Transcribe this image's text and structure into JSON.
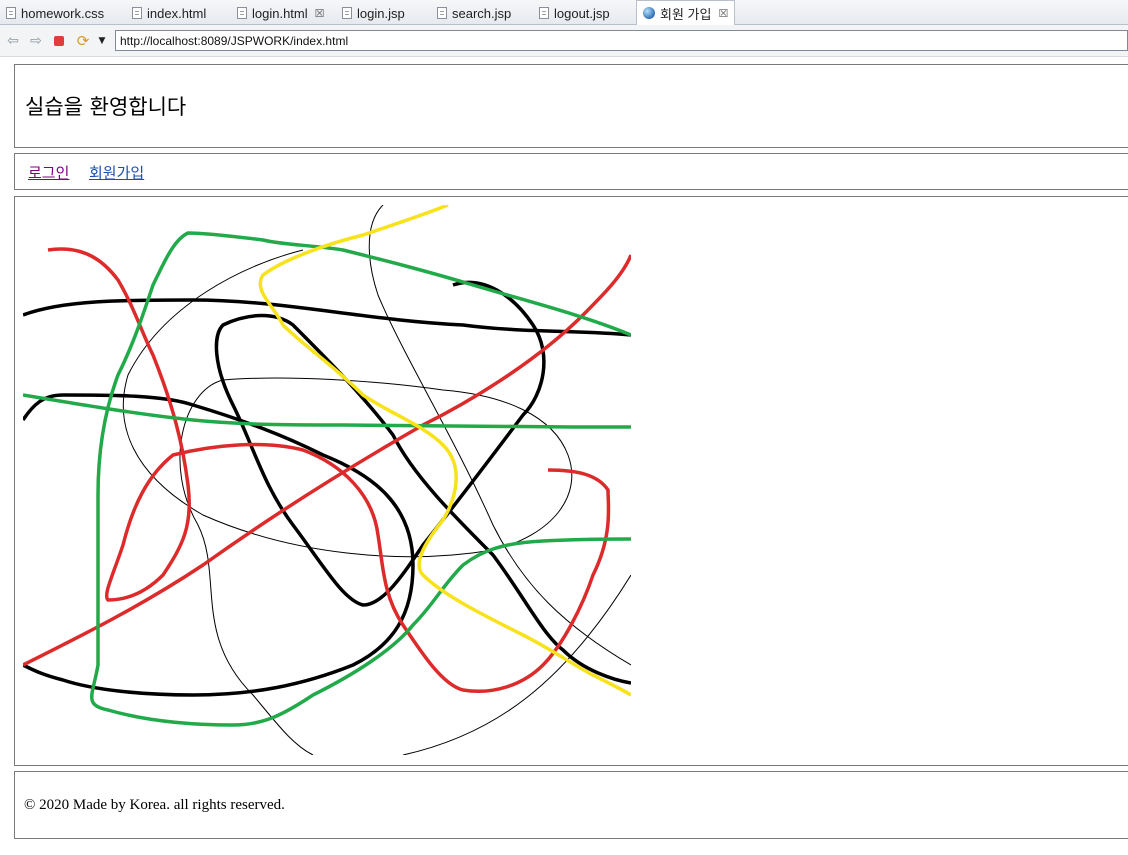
{
  "editor_tabs": [
    {
      "label": "homework.css",
      "icon": "file-icon"
    },
    {
      "label": "index.html",
      "icon": "file-icon"
    },
    {
      "label": "login.html",
      "icon": "file-icon"
    },
    {
      "label": "login.jsp",
      "icon": "file-icon"
    },
    {
      "label": "search.jsp",
      "icon": "file-icon"
    },
    {
      "label": "logout.jsp",
      "icon": "file-icon"
    },
    {
      "label": "회원 가입",
      "icon": "globe-icon",
      "active": true
    }
  ],
  "browser": {
    "url": "http://localhost:8089/JSPWORK/index.html",
    "buttons": [
      "back-icon",
      "forward-icon",
      "stop-icon",
      "refresh-icon",
      "dropdown-icon"
    ]
  },
  "page": {
    "title": "실습을 환영합니다",
    "menu": {
      "login": "로그인",
      "join": "회원가입"
    },
    "footer": "© 2020 Made by Korea. all rights reserved."
  },
  "map_colors": {
    "black": "#000000",
    "red": "#dd2a2a",
    "green": "#22aa4a",
    "yellow": "#f7e21c"
  }
}
